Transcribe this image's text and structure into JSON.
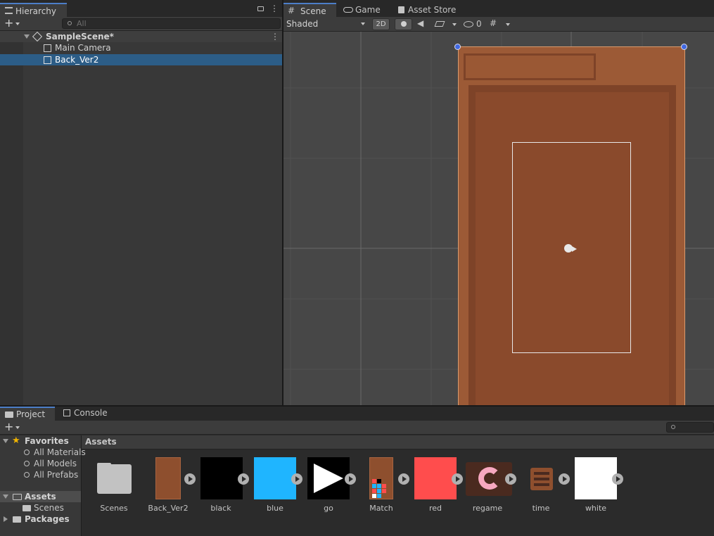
{
  "hierarchy": {
    "tab_label": "Hierarchy",
    "search_placeholder": "All",
    "scene_name": "SampleScene*",
    "items": [
      {
        "label": "Main Camera"
      },
      {
        "label": "Back_Ver2",
        "selected": true
      }
    ]
  },
  "scene_view": {
    "tabs": [
      {
        "label": "Scene",
        "active": true
      },
      {
        "label": "Game"
      },
      {
        "label": "Asset Store"
      }
    ],
    "draw_mode": "Shaded",
    "toggle_2d": "2D",
    "hidden_count": "0"
  },
  "project": {
    "tabs": [
      {
        "label": "Project",
        "active": true
      },
      {
        "label": "Console"
      }
    ],
    "favorites_label": "Favorites",
    "favorites": [
      "All Materials",
      "All Models",
      "All Prefabs"
    ],
    "assets_label": "Assets",
    "asset_subfolders": [
      "Scenes"
    ],
    "packages_label": "Packages",
    "breadcrumb": "Assets",
    "assets": [
      {
        "name": "Scenes",
        "kind": "folder"
      },
      {
        "name": "Back_Ver2",
        "kind": "sprite",
        "color": "#8e4f2e"
      },
      {
        "name": "black",
        "kind": "sprite",
        "color": "#000000"
      },
      {
        "name": "blue",
        "kind": "sprite",
        "color": "#1fb5ff"
      },
      {
        "name": "go",
        "kind": "sprite",
        "color": "#000000"
      },
      {
        "name": "Match",
        "kind": "sprite",
        "color": "#8e4f2e"
      },
      {
        "name": "red",
        "kind": "sprite",
        "color": "#ff4d4d"
      },
      {
        "name": "regame",
        "kind": "sprite",
        "color": "#4a2a1f"
      },
      {
        "name": "time",
        "kind": "sprite",
        "color": "#8e4f2e"
      },
      {
        "name": "white",
        "kind": "sprite",
        "color": "#ffffff"
      }
    ]
  },
  "colors": {
    "accent_selection": "#2c5d87",
    "door_fill": "#8e4f2e"
  }
}
